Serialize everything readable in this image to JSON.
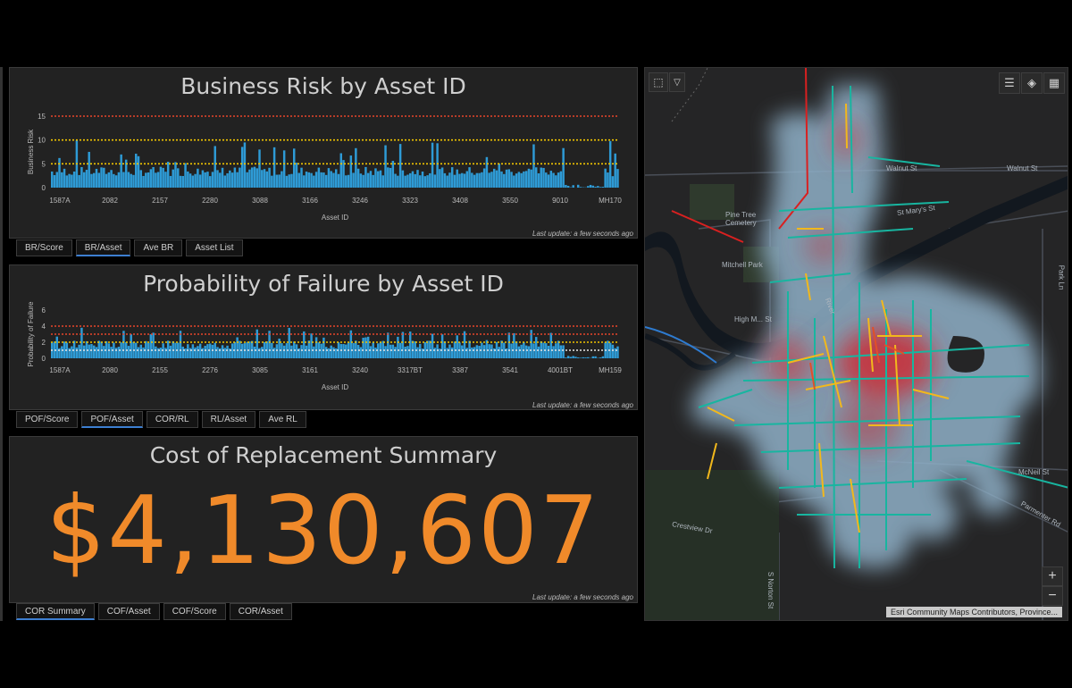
{
  "business_risk": {
    "title": "Business Risk by Asset ID",
    "last_update": "Last update: a few seconds ago",
    "chart_data": {
      "type": "bar",
      "xlabel": "Asset ID",
      "ylabel": "Business Risk",
      "ylim": [
        0,
        15
      ],
      "yticks": [
        "0",
        "5",
        "10",
        "15"
      ],
      "tick_labels": [
        "1587A",
        "2082",
        "2157",
        "2280",
        "3088",
        "3166",
        "3246",
        "3323",
        "3408",
        "3550",
        "9010",
        "MH170"
      ],
      "threshold_lines": [
        15,
        10,
        5
      ],
      "base_level": 4,
      "peak_level": 10
    },
    "tabs": [
      "BR/Score",
      "BR/Asset",
      "Ave BR",
      "Asset List"
    ],
    "active_tab": 1
  },
  "probability_failure": {
    "title": "Probability of Failure by Asset ID",
    "last_update": "Last update: a few seconds ago",
    "chart_data": {
      "type": "bar",
      "xlabel": "Asset ID",
      "ylabel": "Probability of Failure",
      "ylim": [
        0,
        6
      ],
      "yticks": [
        "0",
        "2",
        "4",
        "6"
      ],
      "tick_labels": [
        "1587A",
        "2080",
        "2155",
        "2276",
        "3085",
        "3161",
        "3240",
        "3317BT",
        "3387",
        "3541",
        "4001BT",
        "MH159"
      ],
      "threshold_lines": [
        4,
        3,
        2,
        1
      ],
      "base_level": 2,
      "peak_level": 4
    },
    "tabs": [
      "POF/Score",
      "POF/Asset",
      "COR/RL",
      "RL/Asset",
      "Ave RL"
    ],
    "active_tab": 1
  },
  "cost_replacement": {
    "title": "Cost of Replacement Summary",
    "value": "$4,130,607",
    "last_update": "Last update: a few seconds ago",
    "tabs": [
      "COR Summary",
      "COF/Asset",
      "COF/Score",
      "COR/Asset"
    ],
    "active_tab": 0
  },
  "map": {
    "labels": {
      "walnut_a": "Walnut St",
      "walnut_b": "Walnut St",
      "st_marys": "St Mary's St",
      "pine_tree": "Pine Tree Cemetery",
      "mitchell": "Mitchell Park",
      "high": "High M... St",
      "river": "River",
      "mcneil": "McNeil St",
      "parmenter": "Parmenter Rd",
      "norton": "S Norton St",
      "crestview": "Crestview Dr",
      "park_ln": "Park Ln"
    },
    "attribution": "Esri Community Maps Contributors, Province...",
    "zoom_in": "+",
    "zoom_out": "−"
  },
  "colors": {
    "bar": "#2e9bd6",
    "accent_orange": "#f08a2a",
    "threshold_red": "#e8452a",
    "threshold_yellow": "#f2c500",
    "threshold_white": "#e8e8e8",
    "road_teal": "#18b5a0",
    "road_yellow": "#f2b81c"
  }
}
